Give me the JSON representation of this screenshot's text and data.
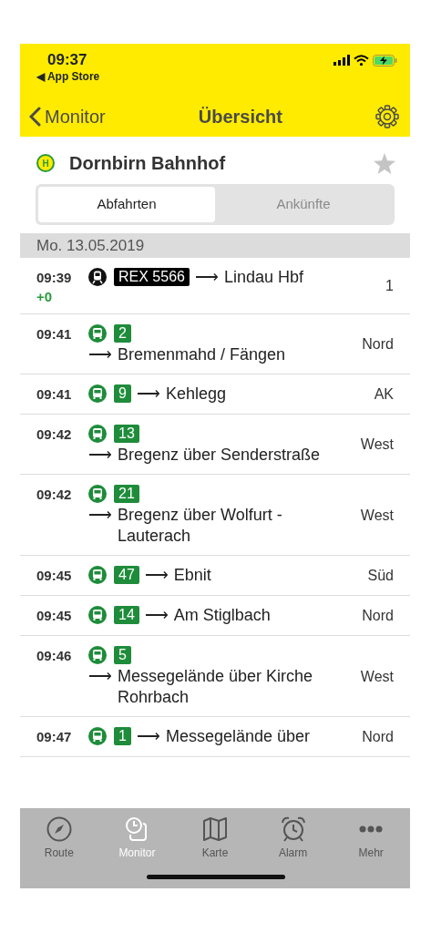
{
  "status_bar": {
    "time": "09:37",
    "back_link": "◀ App Store"
  },
  "nav_bar": {
    "back": "Monitor",
    "title": "Übersicht"
  },
  "station": {
    "symbol": "H",
    "name": "Dornbirn Bahnhof",
    "favorite": false
  },
  "segments": [
    {
      "label": "Abfahrten",
      "selected": true
    },
    {
      "label": "Ankünfte",
      "selected": false
    }
  ],
  "date": "Mo. 13.05.2019",
  "departures": [
    {
      "time": "09:39",
      "delay": "+0",
      "kind": "train",
      "line": "REX 5566",
      "arrow": "⟶",
      "destination": "Lindau Hbf",
      "platform": "1"
    },
    {
      "time": "09:41",
      "kind": "bus",
      "line": "2",
      "arrow": "⟶",
      "destination": "Bremenmahd / Fängen",
      "platform": "Nord"
    },
    {
      "time": "09:41",
      "kind": "bus",
      "line": "9",
      "arrow": "⟶",
      "destination": "Kehlegg",
      "platform": "AK"
    },
    {
      "time": "09:42",
      "kind": "bus",
      "line": "13",
      "arrow": "⟶",
      "destination": "Bregenz über Senderstraße",
      "platform": "West"
    },
    {
      "time": "09:42",
      "kind": "bus",
      "line": "21",
      "arrow": "⟶",
      "destination": "Bregenz über Wolfurt - Lauterach",
      "platform": "West"
    },
    {
      "time": "09:45",
      "kind": "bus",
      "line": "47",
      "arrow": "⟶",
      "destination": "Ebnit",
      "platform": "Süd"
    },
    {
      "time": "09:45",
      "kind": "bus",
      "line": "14",
      "arrow": "⟶",
      "destination": "Am Stiglbach",
      "platform": "Nord"
    },
    {
      "time": "09:46",
      "kind": "bus",
      "line": "5",
      "arrow": "⟶",
      "destination": "Messegelände über Kirche Rohrbach",
      "platform": "West"
    },
    {
      "time": "09:47",
      "kind": "bus",
      "line": "1",
      "arrow": "⟶",
      "destination": "Messegelände über",
      "platform": "Nord"
    }
  ],
  "tab_bar": [
    {
      "label": "Route",
      "kind": "compass",
      "selected": false
    },
    {
      "label": "Monitor",
      "kind": "monitor",
      "selected": true
    },
    {
      "label": "Karte",
      "kind": "map",
      "selected": false
    },
    {
      "label": "Alarm",
      "kind": "alarm",
      "selected": false
    },
    {
      "label": "Mehr",
      "kind": "more",
      "selected": false
    }
  ]
}
